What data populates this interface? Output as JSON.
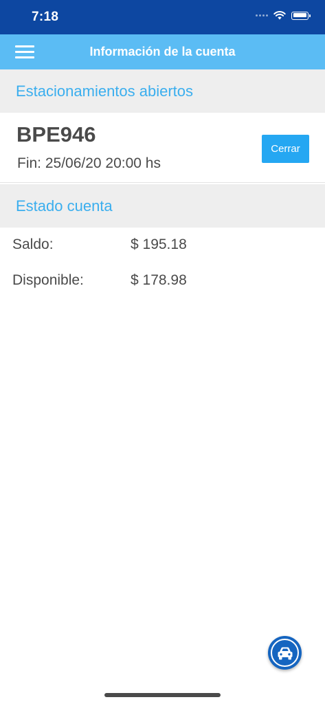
{
  "status_bar": {
    "time": "7:18",
    "icons": [
      "signal-icon",
      "wifi-icon",
      "battery-icon"
    ]
  },
  "header": {
    "title": "Información de la cuenta",
    "menu_icon": "hamburger-menu-icon"
  },
  "open_parking": {
    "section_title": "Estacionamientos abiertos",
    "items": [
      {
        "plate": "BPE946",
        "end_text": "Fin: 25/06/20 20:00 hs",
        "close_label": "Cerrar"
      }
    ]
  },
  "account": {
    "section_title": "Estado cuenta",
    "balance_label": "Saldo:",
    "balance_value": "$ 195.18",
    "available_label": "Disponible:",
    "available_value": "$ 178.98"
  },
  "fab": {
    "icon": "car-icon"
  },
  "colors": {
    "status_bar": "#0d47a1",
    "header": "#5bbcf4",
    "accent_text": "#3aaeee",
    "button": "#25a7f2",
    "fab": "#1565c0",
    "section_bg": "#eeeeee",
    "body_text": "#4a4a4a"
  }
}
